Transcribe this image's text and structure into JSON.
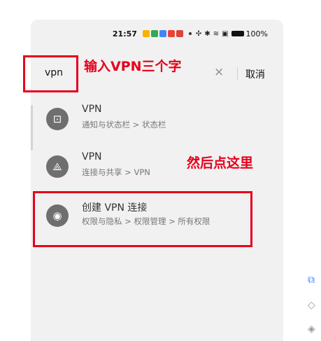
{
  "status_bar": {
    "time": "21:57",
    "battery": "100%",
    "app_icon_colors": [
      "#f4b400",
      "#34a853",
      "#4285f4",
      "#ea4335",
      "#db4437"
    ]
  },
  "search": {
    "value": "vpn",
    "clear_icon": "×",
    "cancel_label": "取消"
  },
  "results": [
    {
      "icon": "notification-icon",
      "glyph": "⊡",
      "title": "VPN",
      "path": "通知与状态栏 > 状态栏"
    },
    {
      "icon": "share-icon",
      "glyph": "⟁",
      "title": "VPN",
      "path": "连接与共享 > VPN"
    },
    {
      "icon": "privacy-icon",
      "glyph": "◉",
      "title": "创建 VPN 连接",
      "path": "权限与隐私 > 权限管理 > 所有权限"
    }
  ],
  "annotations": {
    "search_hint": "输入VPN三个字",
    "click_hint": "然后点这里",
    "color": "#e5001c"
  },
  "side_icons": [
    "⧉",
    "◇",
    "◈"
  ]
}
